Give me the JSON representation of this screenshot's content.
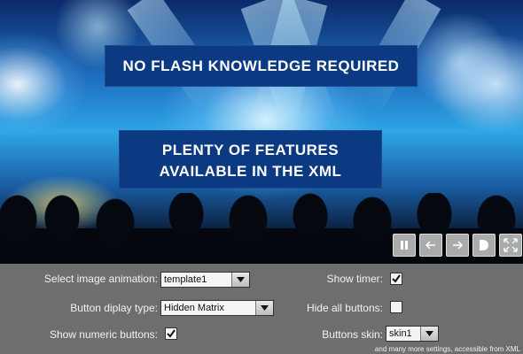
{
  "slideshow": {
    "caption_1": "NO FLASH KNOWLEDGE REQUIRED",
    "caption_2_line1": "PLENTY OF FEATURES",
    "caption_2_line2": "AVAILABLE IN THE XML",
    "controls": [
      "pause-icon",
      "arrow-left-icon",
      "arrow-right-icon",
      "half-circle-icon",
      "fullscreen-icon"
    ]
  },
  "settings": {
    "animation_label": "Select image animation:",
    "animation_value": "template1",
    "button_type_label": "Button diplay type:",
    "button_type_value": "Hidden Matrix",
    "numeric_label": "Show numeric buttons:",
    "numeric_checked": true,
    "timer_label": "Show timer:",
    "timer_checked": true,
    "hide_all_label": "Hide all buttons:",
    "hide_all_checked": false,
    "skin_label": "Buttons skin:",
    "skin_value": "skin1",
    "footnote": "and many more settings, accessible from XML"
  },
  "colors": {
    "caption_bg": "#0b3a83",
    "panel_bg": "#6e6e6e"
  }
}
